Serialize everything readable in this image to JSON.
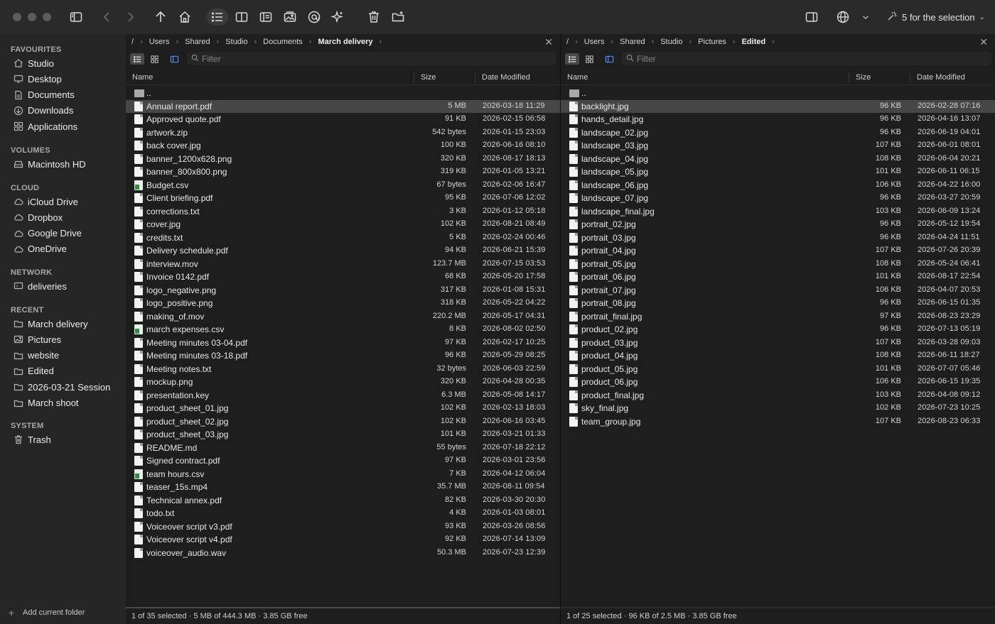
{
  "toolbar": {
    "selection_label": "5 for the selection"
  },
  "sidebar": {
    "sections": [
      {
        "title": "FAVOURITES",
        "items": [
          {
            "label": "Studio",
            "icon": "home-icon"
          },
          {
            "label": "Desktop",
            "icon": "desktop-icon"
          },
          {
            "label": "Documents",
            "icon": "document-icon"
          },
          {
            "label": "Downloads",
            "icon": "download-icon"
          },
          {
            "label": "Applications",
            "icon": "apps-icon"
          }
        ]
      },
      {
        "title": "VOLUMES",
        "items": [
          {
            "label": "Macintosh HD",
            "icon": "disk-icon"
          }
        ]
      },
      {
        "title": "CLOUD",
        "items": [
          {
            "label": "iCloud Drive",
            "icon": "cloud-icon"
          },
          {
            "label": "Dropbox",
            "icon": "cloud-icon"
          },
          {
            "label": "Google Drive",
            "icon": "cloud-icon"
          },
          {
            "label": "OneDrive",
            "icon": "cloud-icon"
          }
        ]
      },
      {
        "title": "NETWORK",
        "items": [
          {
            "label": "deliveries",
            "icon": "network-drive-icon"
          }
        ]
      },
      {
        "title": "RECENT",
        "items": [
          {
            "label": "March delivery",
            "icon": "folder-icon"
          },
          {
            "label": "Pictures",
            "icon": "pictures-icon"
          },
          {
            "label": "website",
            "icon": "folder-icon"
          },
          {
            "label": "Edited",
            "icon": "folder-icon"
          },
          {
            "label": "2026-03-21 Session",
            "icon": "folder-icon"
          },
          {
            "label": "March shoot",
            "icon": "folder-icon"
          }
        ]
      },
      {
        "title": "SYSTEM",
        "items": [
          {
            "label": "Trash",
            "icon": "trash-icon"
          }
        ]
      }
    ],
    "add_folder_label": "Add current folder"
  },
  "left_pane": {
    "breadcrumb": [
      "/",
      "Users",
      "Shared",
      "Studio",
      "Documents",
      "March delivery"
    ],
    "filter_placeholder": "Filter",
    "columns": {
      "name": "Name",
      "size": "Size",
      "date": "Date Modified"
    },
    "parent_label": "..",
    "files": [
      {
        "name": "Annual report.pdf",
        "size": "5 MB",
        "date": "2026-03-18 11:29",
        "kind": "doc",
        "selected": true
      },
      {
        "name": "Approved quote.pdf",
        "size": "91 KB",
        "date": "2026-02-15 06:58",
        "kind": "doc"
      },
      {
        "name": "artwork.zip",
        "size": "542 bytes",
        "date": "2026-01-15 23:03",
        "kind": "doc"
      },
      {
        "name": "back cover.jpg",
        "size": "100 KB",
        "date": "2026-06-16 08:10",
        "kind": "doc"
      },
      {
        "name": "banner_1200x628.png",
        "size": "320 KB",
        "date": "2026-08-17 18:13",
        "kind": "doc"
      },
      {
        "name": "banner_800x800.png",
        "size": "319 KB",
        "date": "2026-01-05 13:21",
        "kind": "doc"
      },
      {
        "name": "Budget.csv",
        "size": "67 bytes",
        "date": "2026-02-06 16:47",
        "kind": "csv"
      },
      {
        "name": "Client briefing.pdf",
        "size": "95 KB",
        "date": "2026-07-06 12:02",
        "kind": "doc"
      },
      {
        "name": "corrections.txt",
        "size": "3 KB",
        "date": "2026-01-12 05:18",
        "kind": "doc"
      },
      {
        "name": "cover.jpg",
        "size": "102 KB",
        "date": "2026-08-21 08:49",
        "kind": "doc"
      },
      {
        "name": "credits.txt",
        "size": "5 KB",
        "date": "2026-02-24 00:46",
        "kind": "doc"
      },
      {
        "name": "Delivery schedule.pdf",
        "size": "94 KB",
        "date": "2026-06-21 15:39",
        "kind": "doc"
      },
      {
        "name": "interview.mov",
        "size": "123.7 MB",
        "date": "2026-07-15 03:53",
        "kind": "doc"
      },
      {
        "name": "Invoice 0142.pdf",
        "size": "68 KB",
        "date": "2026-05-20 17:58",
        "kind": "doc"
      },
      {
        "name": "logo_negative.png",
        "size": "317 KB",
        "date": "2026-01-08 15:31",
        "kind": "doc"
      },
      {
        "name": "logo_positive.png",
        "size": "318 KB",
        "date": "2026-05-22 04:22",
        "kind": "doc"
      },
      {
        "name": "making_of.mov",
        "size": "220.2 MB",
        "date": "2026-05-17 04:31",
        "kind": "doc"
      },
      {
        "name": "march expenses.csv",
        "size": "8 KB",
        "date": "2026-08-02 02:50",
        "kind": "csv"
      },
      {
        "name": "Meeting minutes 03-04.pdf",
        "size": "97 KB",
        "date": "2026-02-17 10:25",
        "kind": "doc"
      },
      {
        "name": "Meeting minutes 03-18.pdf",
        "size": "96 KB",
        "date": "2026-05-29 08:25",
        "kind": "doc"
      },
      {
        "name": "Meeting notes.txt",
        "size": "32 bytes",
        "date": "2026-06-03 22:59",
        "kind": "doc"
      },
      {
        "name": "mockup.png",
        "size": "320 KB",
        "date": "2026-04-28 00:35",
        "kind": "doc"
      },
      {
        "name": "presentation.key",
        "size": "6.3 MB",
        "date": "2026-05-08 14:17",
        "kind": "doc"
      },
      {
        "name": "product_sheet_01.jpg",
        "size": "102 KB",
        "date": "2026-02-13 18:03",
        "kind": "doc"
      },
      {
        "name": "product_sheet_02.jpg",
        "size": "102 KB",
        "date": "2026-06-16 03:45",
        "kind": "doc"
      },
      {
        "name": "product_sheet_03.jpg",
        "size": "101 KB",
        "date": "2026-03-21 01:33",
        "kind": "doc"
      },
      {
        "name": "README.md",
        "size": "55 bytes",
        "date": "2026-07-18 22:12",
        "kind": "doc"
      },
      {
        "name": "Signed contract.pdf",
        "size": "97 KB",
        "date": "2026-03-01 23:56",
        "kind": "doc"
      },
      {
        "name": "team hours.csv",
        "size": "7 KB",
        "date": "2026-04-12 06:04",
        "kind": "csv"
      },
      {
        "name": "teaser_15s.mp4",
        "size": "35.7 MB",
        "date": "2026-08-11 09:54",
        "kind": "doc"
      },
      {
        "name": "Technical annex.pdf",
        "size": "82 KB",
        "date": "2026-03-30 20:30",
        "kind": "doc"
      },
      {
        "name": "todo.txt",
        "size": "4 KB",
        "date": "2026-01-03 08:01",
        "kind": "doc"
      },
      {
        "name": "Voiceover script v3.pdf",
        "size": "93 KB",
        "date": "2026-03-26 08:56",
        "kind": "doc"
      },
      {
        "name": "Voiceover script v4.pdf",
        "size": "92 KB",
        "date": "2026-07-14 13:09",
        "kind": "doc"
      },
      {
        "name": "voiceover_audio.wav",
        "size": "50.3 MB",
        "date": "2026-07-23 12:39",
        "kind": "doc"
      }
    ],
    "status": "1 of 35 selected · 5 MB of 444.3 MB · 3.85 GB free"
  },
  "right_pane": {
    "breadcrumb": [
      "/",
      "Users",
      "Shared",
      "Studio",
      "Pictures",
      "Edited"
    ],
    "filter_placeholder": "Filter",
    "columns": {
      "name": "Name",
      "size": "Size",
      "date": "Date Modified"
    },
    "parent_label": "..",
    "files": [
      {
        "name": "backlight.jpg",
        "size": "96 KB",
        "date": "2026-02-28 07:16",
        "kind": "doc",
        "selected": true
      },
      {
        "name": "hands_detail.jpg",
        "size": "96 KB",
        "date": "2026-04-16 13:07",
        "kind": "doc"
      },
      {
        "name": "landscape_02.jpg",
        "size": "96 KB",
        "date": "2026-06-19 04:01",
        "kind": "doc"
      },
      {
        "name": "landscape_03.jpg",
        "size": "107 KB",
        "date": "2026-06-01 08:01",
        "kind": "doc"
      },
      {
        "name": "landscape_04.jpg",
        "size": "108 KB",
        "date": "2026-06-04 20:21",
        "kind": "doc"
      },
      {
        "name": "landscape_05.jpg",
        "size": "101 KB",
        "date": "2026-06-11 06:15",
        "kind": "doc"
      },
      {
        "name": "landscape_06.jpg",
        "size": "106 KB",
        "date": "2026-04-22 16:00",
        "kind": "doc"
      },
      {
        "name": "landscape_07.jpg",
        "size": "96 KB",
        "date": "2026-03-27 20:59",
        "kind": "doc"
      },
      {
        "name": "landscape_final.jpg",
        "size": "103 KB",
        "date": "2026-06-09 13:24",
        "kind": "doc"
      },
      {
        "name": "portrait_02.jpg",
        "size": "96 KB",
        "date": "2026-05-12 19:54",
        "kind": "doc"
      },
      {
        "name": "portrait_03.jpg",
        "size": "96 KB",
        "date": "2026-04-24 11:51",
        "kind": "doc"
      },
      {
        "name": "portrait_04.jpg",
        "size": "107 KB",
        "date": "2026-07-26 20:39",
        "kind": "doc"
      },
      {
        "name": "portrait_05.jpg",
        "size": "108 KB",
        "date": "2026-05-24 06:41",
        "kind": "doc"
      },
      {
        "name": "portrait_06.jpg",
        "size": "101 KB",
        "date": "2026-08-17 22:54",
        "kind": "doc"
      },
      {
        "name": "portrait_07.jpg",
        "size": "106 KB",
        "date": "2026-04-07 20:53",
        "kind": "doc"
      },
      {
        "name": "portrait_08.jpg",
        "size": "96 KB",
        "date": "2026-06-15 01:35",
        "kind": "doc"
      },
      {
        "name": "portrait_final.jpg",
        "size": "97 KB",
        "date": "2026-08-23 23:29",
        "kind": "doc"
      },
      {
        "name": "product_02.jpg",
        "size": "96 KB",
        "date": "2026-07-13 05:19",
        "kind": "doc"
      },
      {
        "name": "product_03.jpg",
        "size": "107 KB",
        "date": "2026-03-28 09:03",
        "kind": "doc"
      },
      {
        "name": "product_04.jpg",
        "size": "108 KB",
        "date": "2026-06-11 18:27",
        "kind": "doc"
      },
      {
        "name": "product_05.jpg",
        "size": "101 KB",
        "date": "2026-07-07 05:46",
        "kind": "doc"
      },
      {
        "name": "product_06.jpg",
        "size": "106 KB",
        "date": "2026-06-15 19:35",
        "kind": "doc"
      },
      {
        "name": "product_final.jpg",
        "size": "103 KB",
        "date": "2026-04-08 09:12",
        "kind": "doc"
      },
      {
        "name": "sky_final.jpg",
        "size": "102 KB",
        "date": "2026-07-23 10:25",
        "kind": "doc"
      },
      {
        "name": "team_group.jpg",
        "size": "107 KB",
        "date": "2026-08-23 06:33",
        "kind": "doc"
      }
    ],
    "status": "1 of 25 selected · 96 KB of 2.5 MB · 3.85 GB free"
  }
}
